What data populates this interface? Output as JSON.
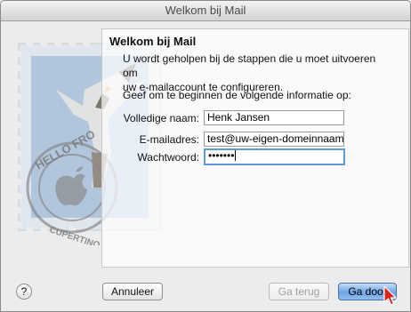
{
  "window": {
    "title": "Welkom bij Mail"
  },
  "intro": {
    "heading": "Welkom bij Mail",
    "line1": "U wordt geholpen bij de stappen die u moet uitvoeren om",
    "line2": "uw e-mailaccount te configureren.",
    "prompt": "Geef om te beginnen de volgende informatie op:"
  },
  "form": {
    "full_name_label": "Volledige naam:",
    "full_name_value": "Henk Jansen",
    "email_label": "E-mailadres:",
    "email_value": "test@uw-eigen-domeinnaam.n",
    "password_label": "Wachtwoord:",
    "password_value": "•••••••"
  },
  "buttons": {
    "help": "?",
    "cancel": "Annuleer",
    "back": "Ga terug",
    "next": "Ga door"
  },
  "colors": {
    "focus_ring": "#5b9bd8",
    "default_button": "#6ea5e5"
  },
  "icons": {
    "stamp": "hello-from-cupertino-stamp-icon",
    "cursor": "mouse-pointer-icon"
  }
}
